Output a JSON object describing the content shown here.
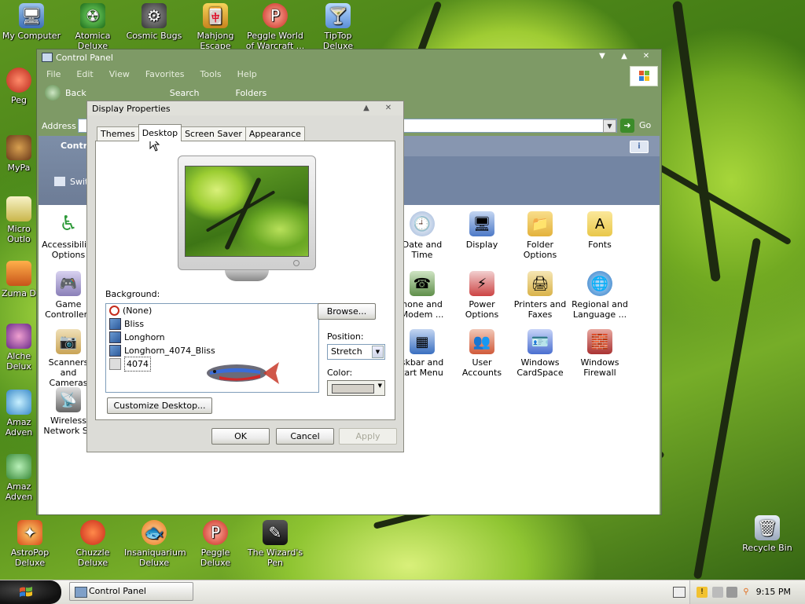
{
  "desktop": {
    "top_icons": [
      "My Computer",
      "Atomica Deluxe",
      "Cosmic Bugs",
      "Mahjong Escape Anci...",
      "Peggle World of Warcraft ...",
      "TipTop Deluxe"
    ],
    "left_icons": [
      "Peg",
      "MyPa",
      "Micro Outlo",
      "Zuma D",
      "Alche Delux",
      "Amaz Adven",
      "Amaz Adven"
    ],
    "bottom_icons": [
      "AstroPop Deluxe",
      "Chuzzle Deluxe",
      "Insaniquarium Deluxe",
      "Peggle Deluxe",
      "The Wizard's Pen"
    ],
    "recycle_bin": "Recycle Bin"
  },
  "control_panel": {
    "title": "Control Panel",
    "menu": [
      "File",
      "Edit",
      "View",
      "Favorites",
      "Tools",
      "Help"
    ],
    "toolbar": {
      "back": "Back",
      "search": "Search",
      "folders": "Folders"
    },
    "address_label": "Address",
    "go_label": "Go",
    "side_title": "Contr",
    "switch_label": "Swit",
    "items": [
      {
        "label": "Accessibility Options",
        "icon": "accessibility-icon",
        "color": "#2e9a3a"
      },
      {
        "label": "Date and Time",
        "icon": "clock-icon",
        "color": "#5b7fb5"
      },
      {
        "label": "Display",
        "icon": "display-icon",
        "color": "#4d79c7"
      },
      {
        "label": "Folder Options",
        "icon": "folder-icon",
        "color": "#e3b23c"
      },
      {
        "label": "Fonts",
        "icon": "fonts-icon",
        "color": "#e9c84a"
      },
      {
        "label": "Game Controllers",
        "icon": "gamepad-icon",
        "color": "#8a7fb8"
      },
      {
        "label": "hone and Modem ...",
        "icon": "phone-icon",
        "color": "#5f8f4a"
      },
      {
        "label": "Power Options",
        "icon": "power-icon",
        "color": "#c44"
      },
      {
        "label": "Printers and Faxes",
        "icon": "printer-icon",
        "color": "#d9b34a"
      },
      {
        "label": "Regional and Language ...",
        "icon": "globe-icon",
        "color": "#2f78c4"
      },
      {
        "label": "Scanners and Cameras",
        "icon": "scanner-icon",
        "color": "#c9a456"
      },
      {
        "label": "skbar and tart Menu",
        "icon": "taskbar-icon",
        "color": "#3a6fc0"
      },
      {
        "label": "User Accounts",
        "icon": "users-icon",
        "color": "#d05a3a"
      },
      {
        "label": "Windows CardSpace",
        "icon": "cardspace-icon",
        "color": "#4a6fd0"
      },
      {
        "label": "Windows Firewall",
        "icon": "firewall-icon",
        "color": "#a33"
      },
      {
        "label": "Wireless Network Se",
        "icon": "wireless-icon",
        "color": "#666"
      }
    ]
  },
  "display_properties": {
    "title": "Display Properties",
    "tabs": [
      "Themes",
      "Desktop",
      "Screen Saver",
      "Appearance"
    ],
    "background_label": "Background:",
    "backgrounds": [
      "(None)",
      "Bliss",
      "Longhorn",
      "Longhorn_4074_Bliss",
      "4074"
    ],
    "browse": "Browse...",
    "position_label": "Position:",
    "position_value": "Stretch",
    "color_label": "Color:",
    "customize": "Customize Desktop...",
    "ok": "OK",
    "cancel": "Cancel",
    "apply": "Apply"
  },
  "taskbar": {
    "task": "Control Panel",
    "clock": "9:15 PM"
  }
}
